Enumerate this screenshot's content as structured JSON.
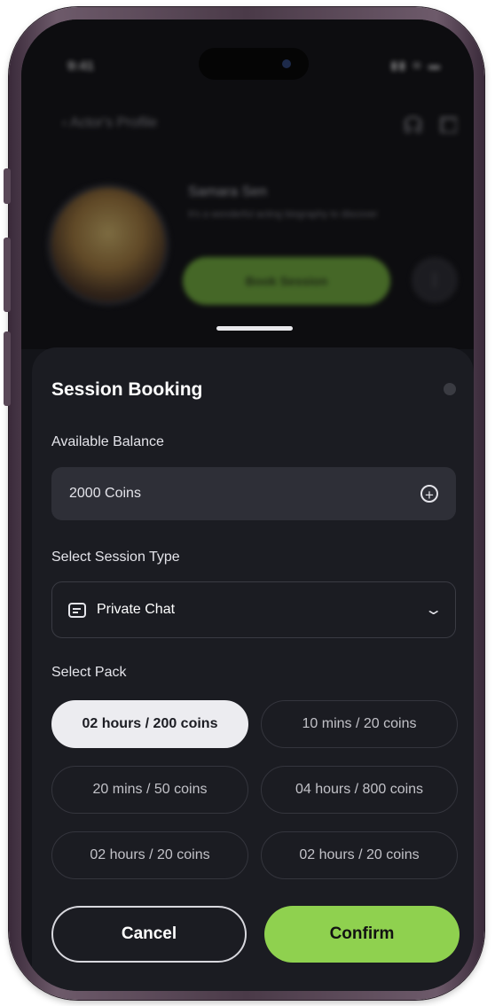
{
  "status_bar": {
    "time": "9:41",
    "icons": "▮▮ ≋ ▬"
  },
  "background_profile": {
    "back_label": "‹  Actor's Profile",
    "name": "Samara Sen",
    "bio": "It's a wonderful acting biography to discover",
    "book_label": "Book Session",
    "more": "⋮"
  },
  "sheet": {
    "title": "Session Booking",
    "balance": {
      "label": "Available Balance",
      "value": "2000 Coins",
      "add_icon": "+"
    },
    "session_type": {
      "label": "Select Session Type",
      "value": "Private Chat",
      "chevron": "⌄"
    },
    "pack": {
      "label": "Select Pack",
      "options": [
        "02 hours / 200 coins",
        "10 mins / 20 coins",
        "20 mins / 50 coins",
        "04 hours / 800 coins",
        "02 hours / 20 coins",
        "02 hours / 20 coins"
      ],
      "selected_index": 0
    },
    "buttons": {
      "cancel": "Cancel",
      "confirm": "Confirm"
    }
  },
  "colors": {
    "accent": "#8fd14f",
    "sheet_bg": "#1b1c22",
    "field_bg": "#2e2f37"
  }
}
